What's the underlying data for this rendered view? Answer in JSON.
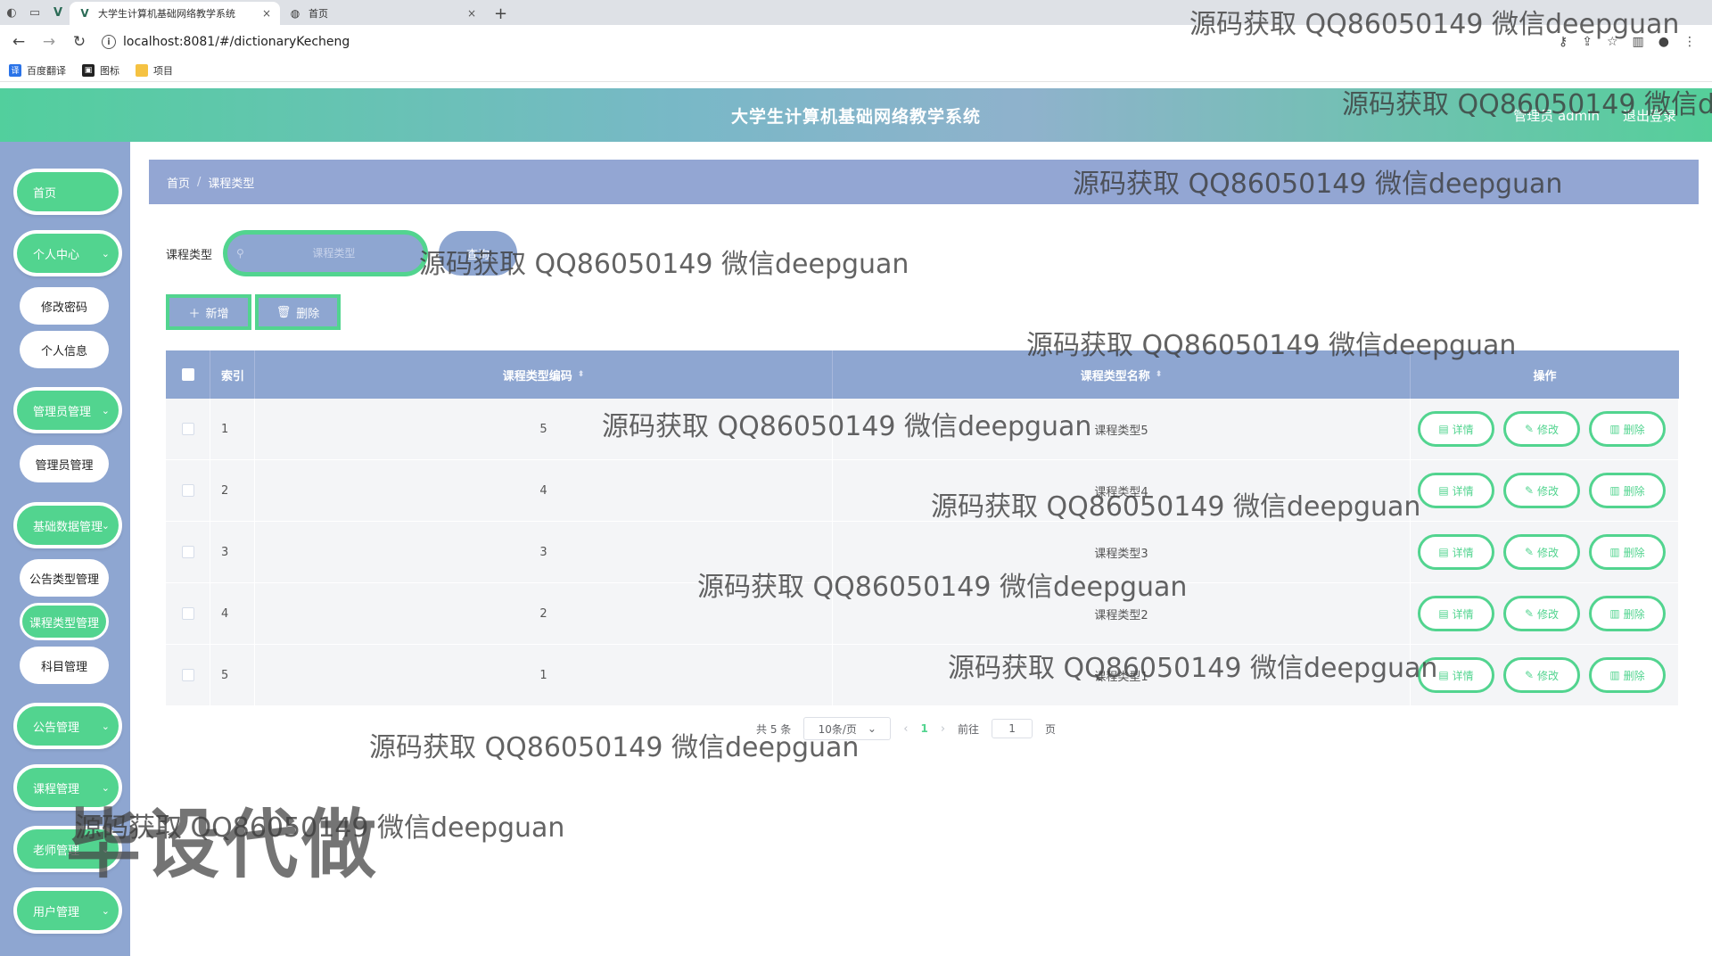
{
  "browser": {
    "tabs": [
      {
        "title": "大学生计算机基础网络教学系统",
        "active": true
      },
      {
        "title": "首页",
        "active": false
      }
    ],
    "new_tab": "+",
    "close": "×",
    "url": "localhost:8081/#/dictionaryKecheng",
    "bookmarks": [
      {
        "label": "百度翻译",
        "icon": "translate-icon",
        "color": "#2a73e8"
      },
      {
        "label": "图标",
        "icon": "image-icon",
        "color": "#222222"
      },
      {
        "label": "项目",
        "icon": "folder-icon",
        "color": "#f5c242"
      }
    ]
  },
  "header": {
    "title": "大学生计算机基础网络教学系统",
    "user": "管理员 admin",
    "logout": "退出登录"
  },
  "sidebar": {
    "items": [
      {
        "label": "首页",
        "type": "menu",
        "expandable": false
      },
      {
        "label": "个人中心",
        "type": "menu",
        "expandable": true
      },
      {
        "label": "修改密码",
        "type": "sub"
      },
      {
        "label": "个人信息",
        "type": "sub"
      },
      {
        "label": "管理员管理",
        "type": "menu",
        "expandable": true
      },
      {
        "label": "管理员管理",
        "type": "sub"
      },
      {
        "label": "基础数据管理",
        "type": "menu",
        "expandable": true
      },
      {
        "label": "公告类型管理",
        "type": "sub"
      },
      {
        "label": "课程类型管理",
        "type": "sub",
        "active": true
      },
      {
        "label": "科目管理",
        "type": "sub"
      },
      {
        "label": "公告管理",
        "type": "menu",
        "expandable": true
      },
      {
        "label": "课程管理",
        "type": "menu",
        "expandable": true
      },
      {
        "label": "老师管理",
        "type": "menu",
        "expandable": true
      },
      {
        "label": "用户管理",
        "type": "menu",
        "expandable": true
      }
    ]
  },
  "breadcrumb": {
    "home": "首页",
    "sep": "/",
    "current": "课程类型"
  },
  "search": {
    "label": "课程类型",
    "placeholder": "课程类型",
    "button": "查询"
  },
  "actions": {
    "add": "新增",
    "delete": "删除"
  },
  "table": {
    "columns": {
      "index": "索引",
      "code": "课程类型编码",
      "name": "课程类型名称",
      "ops": "操作"
    },
    "rows": [
      {
        "index": "1",
        "code": "5",
        "name": "课程类型5"
      },
      {
        "index": "2",
        "code": "4",
        "name": "课程类型4"
      },
      {
        "index": "3",
        "code": "3",
        "name": "课程类型3"
      },
      {
        "index": "4",
        "code": "2",
        "name": "课程类型2"
      },
      {
        "index": "5",
        "code": "1",
        "name": "课程类型1"
      }
    ],
    "op_labels": {
      "detail": "详情",
      "edit": "修改",
      "delete": "删除"
    }
  },
  "pagination": {
    "total": "共 5 条",
    "page_size": "10条/页",
    "current_page": "1",
    "goto_label": "前往",
    "goto_value": "1",
    "page_suffix": "页"
  },
  "watermarks": {
    "text": "源码获取 QQ86050149 微信deepguan",
    "big": "毕设代做"
  },
  "colors": {
    "accent_green": "#52d48f",
    "panel_blue": "#8ea6d1",
    "breadcrumb_blue": "#93a6d3"
  }
}
